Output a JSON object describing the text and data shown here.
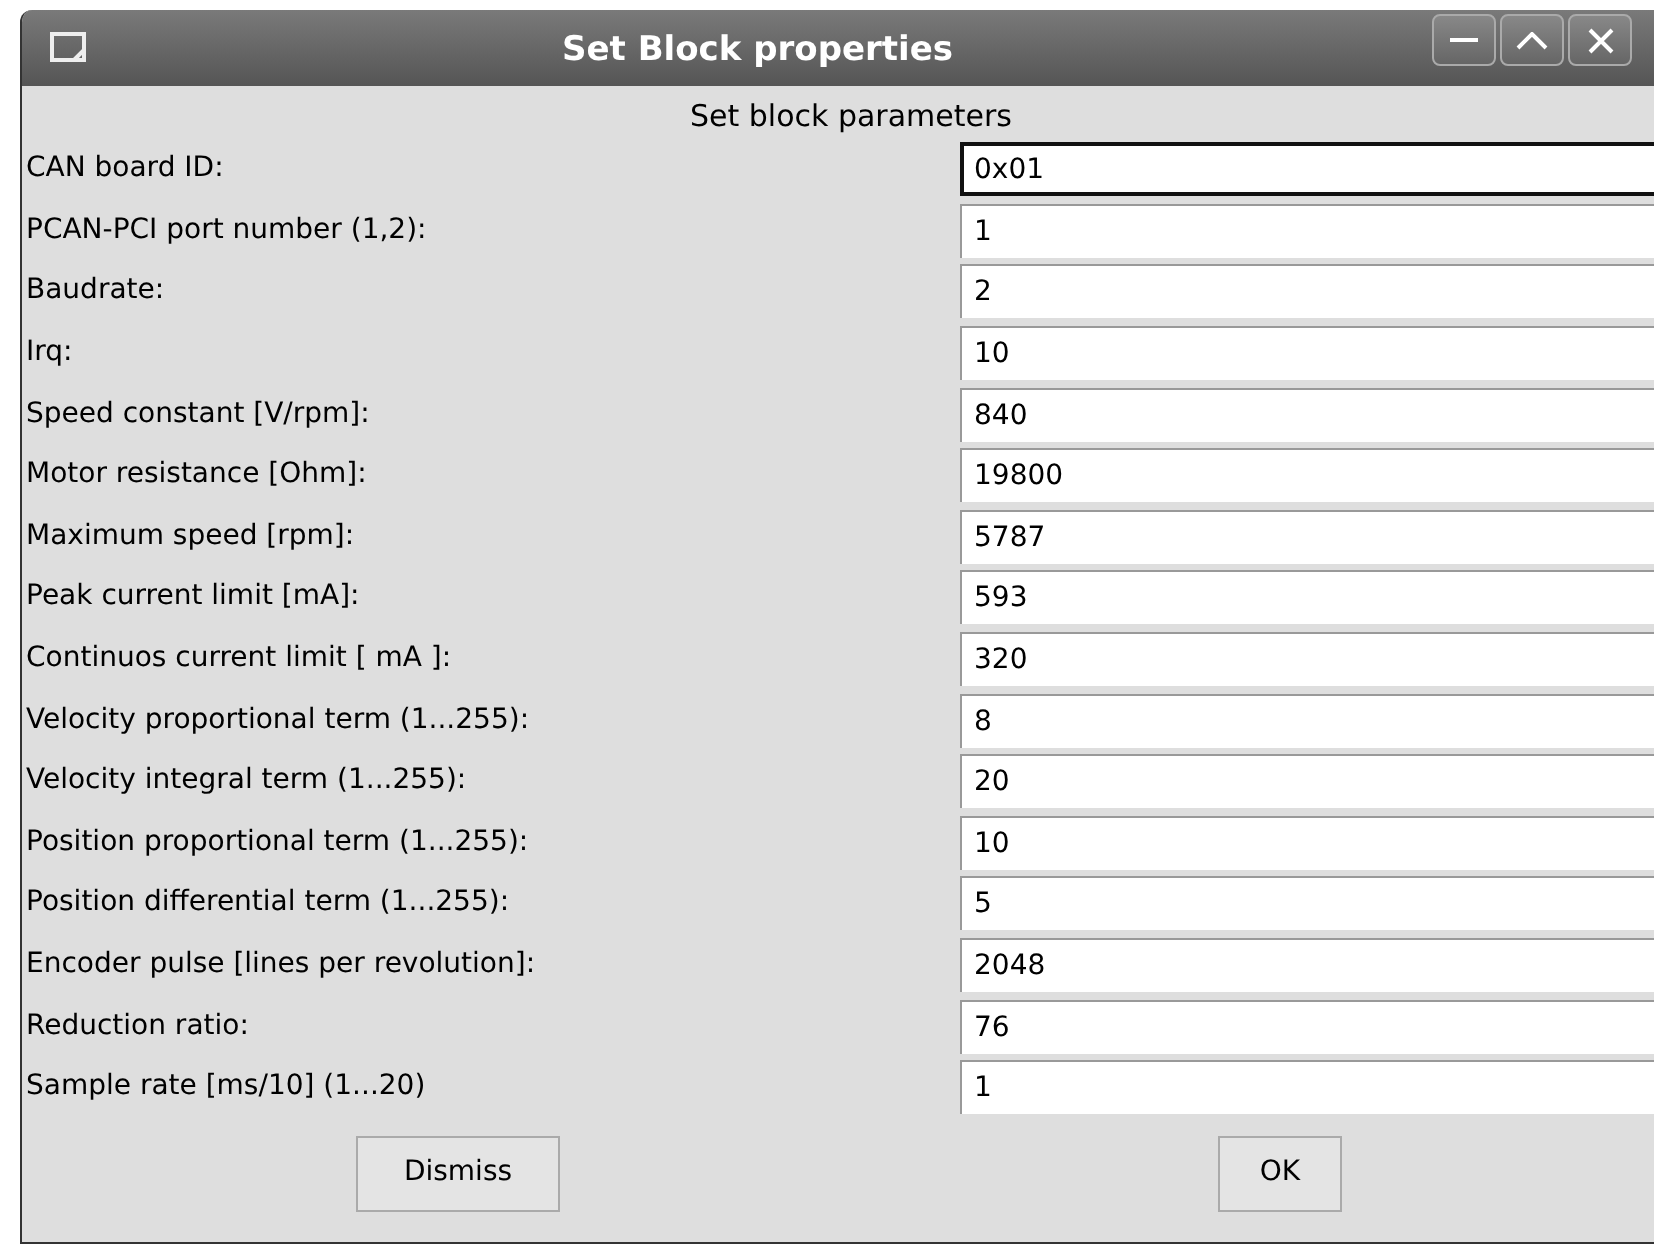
{
  "window": {
    "title": "Set Block properties"
  },
  "heading": "Set block parameters",
  "parameters": [
    {
      "label": "CAN board ID:",
      "value": "0x01",
      "focused": true
    },
    {
      "label": "PCAN-PCI port number (1,2):",
      "value": "1",
      "focused": false
    },
    {
      "label": "Baudrate:",
      "value": "2",
      "focused": false
    },
    {
      "label": "Irq:",
      "value": "10",
      "focused": false
    },
    {
      "label": "Speed constant [V/rpm]:",
      "value": "840",
      "focused": false
    },
    {
      "label": "Motor resistance [Ohm]:",
      "value": "19800",
      "focused": false
    },
    {
      "label": "Maximum speed [rpm]:",
      "value": "5787",
      "focused": false
    },
    {
      "label": "Peak current limit [mA]:",
      "value": "593",
      "focused": false
    },
    {
      "label": "Continuos current limit [ mA ]:",
      "value": "320",
      "focused": false
    },
    {
      "label": "Velocity proportional term (1...255):",
      "value": "8",
      "focused": false
    },
    {
      "label": "Velocity integral term (1...255):",
      "value": "20",
      "focused": false
    },
    {
      "label": "Position proportional term (1...255):",
      "value": "10",
      "focused": false
    },
    {
      "label": "Position differential term (1...255):",
      "value": "5",
      "focused": false
    },
    {
      "label": "Encoder pulse [lines per revolution]:",
      "value": "2048",
      "focused": false
    },
    {
      "label": "Reduction ratio:",
      "value": "76",
      "focused": false
    },
    {
      "label": "Sample rate [ms/10] (1...20)",
      "value": "1",
      "focused": false
    }
  ],
  "buttons": [
    "Dismiss",
    "OK"
  ]
}
